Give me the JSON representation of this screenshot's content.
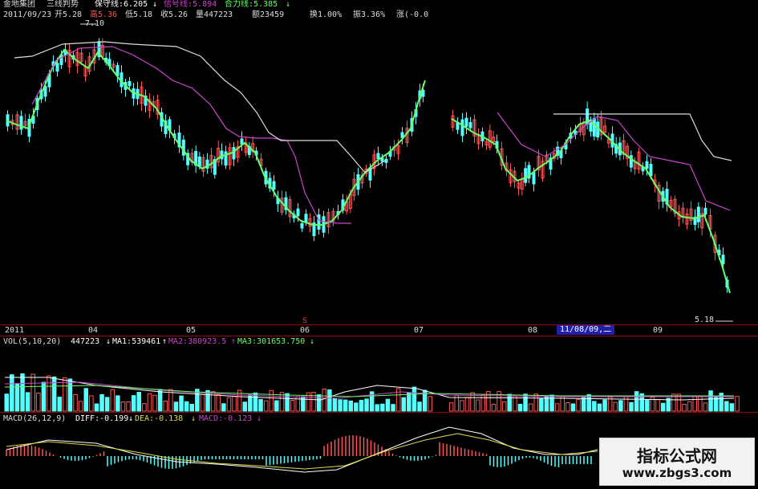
{
  "header": {
    "stock_name": "金地集团",
    "indicator_name": "三线判势",
    "guard_line": "保守线:6.205",
    "signal_line": "信号线:5.894",
    "force_line": "合力线:5.385",
    "date": "2011/09/23",
    "open": "开5.28",
    "high": "高5.36",
    "low": "低5.18",
    "close": "收5.26",
    "volume": "量447223",
    "amount": "额23459",
    "turnover": "换1.00%",
    "amplitude": "振3.36%",
    "change": "涨(-0.0"
  },
  "price_panel": {
    "high_marker": "7.10",
    "low_marker": "5.18"
  },
  "time_axis": {
    "labels": [
      "2011",
      "04",
      "05",
      "06",
      "07",
      "08",
      "09"
    ],
    "cursor_date": "11/08/09,二"
  },
  "volume_panel": {
    "title": "VOL(5,10,20)",
    "vol": "447223",
    "ma1": "MA1:539461",
    "ma2": "MA2:380923.5",
    "ma3": "MA3:301653.750"
  },
  "macd_panel": {
    "title": "MACD(26,12,9)",
    "diff": "DIFF:-0.199",
    "dea": "DEA:-0.138",
    "macd": "MACD:-0.123"
  },
  "watermark": {
    "line1": "指标公式网",
    "line2": "www.zbgs3.com"
  },
  "colors": {
    "up": "#ff5555",
    "down": "#55ffff",
    "ma_green": "#66ff66",
    "guard_line": "#dddddd",
    "signal_line": "#cc44cc",
    "grid": "#8a0a0a"
  }
}
